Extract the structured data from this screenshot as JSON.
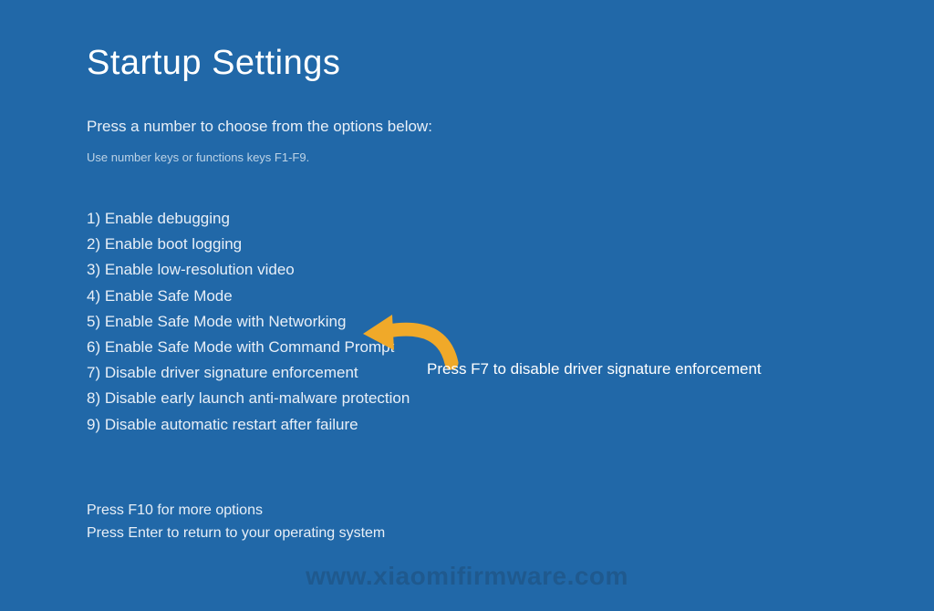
{
  "title": "Startup Settings",
  "instruction": "Press a number to choose from the options below:",
  "hint": "Use number keys or functions keys F1-F9.",
  "options": [
    "1) Enable debugging",
    "2) Enable boot logging",
    "3) Enable low-resolution video",
    "4) Enable Safe Mode",
    "5) Enable Safe Mode with Networking",
    "6) Enable Safe Mode with Command Prompt",
    "7) Disable driver signature enforcement",
    "8) Disable early launch anti-malware protection",
    "9) Disable automatic restart after failure"
  ],
  "footer": {
    "line1": "Press F10 for more options",
    "line2": "Press Enter to return to your operating system"
  },
  "annotation": {
    "text": "Press F7 to disable driver signature enforcement"
  },
  "watermark": "www.xiaomifirmware.com"
}
